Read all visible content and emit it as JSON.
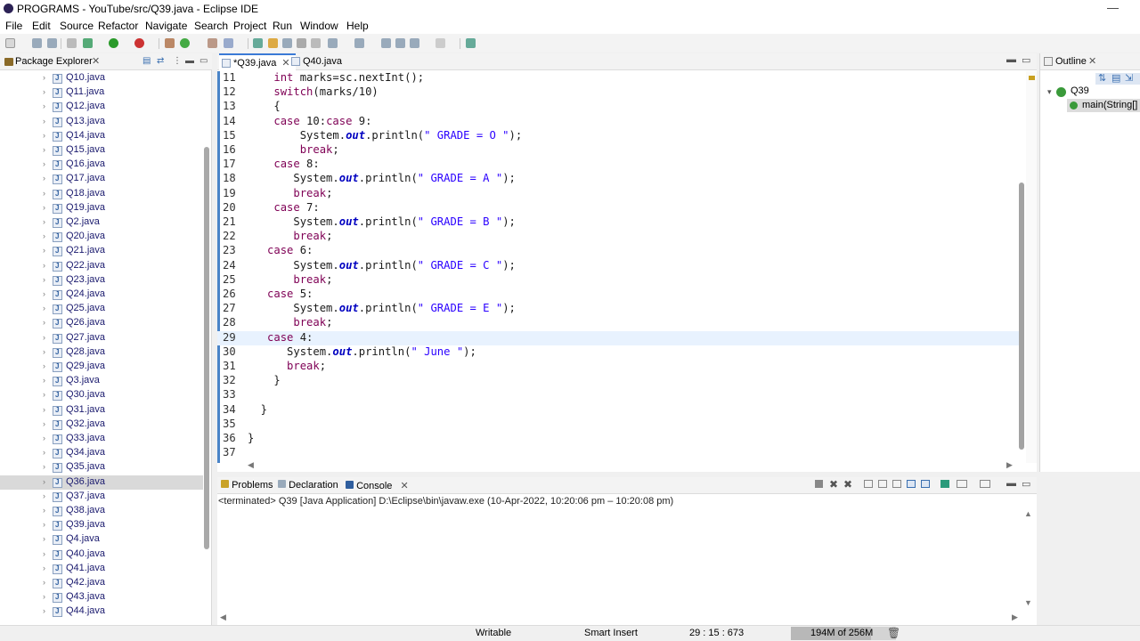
{
  "window": {
    "title": "PROGRAMS - YouTube/src/Q39.java - Eclipse IDE",
    "minimize": "—"
  },
  "menu": [
    "File",
    "Edit",
    "Source",
    "Refactor",
    "Navigate",
    "Search",
    "Project",
    "Run",
    "Window",
    "Help"
  ],
  "package_explorer": {
    "title": "Package Explorer",
    "files": [
      "Q10.java",
      "Q11.java",
      "Q12.java",
      "Q13.java",
      "Q14.java",
      "Q15.java",
      "Q16.java",
      "Q17.java",
      "Q18.java",
      "Q19.java",
      "Q2.java",
      "Q20.java",
      "Q21.java",
      "Q22.java",
      "Q23.java",
      "Q24.java",
      "Q25.java",
      "Q26.java",
      "Q27.java",
      "Q28.java",
      "Q29.java",
      "Q3.java",
      "Q30.java",
      "Q31.java",
      "Q32.java",
      "Q33.java",
      "Q34.java",
      "Q35.java",
      "Q36.java",
      "Q37.java",
      "Q38.java",
      "Q39.java",
      "Q4.java",
      "Q40.java",
      "Q41.java",
      "Q42.java",
      "Q43.java",
      "Q44.java"
    ],
    "selected": "Q36.java"
  },
  "editor": {
    "tabs": [
      {
        "label": "*Q39.java",
        "active": true
      },
      {
        "label": "Q40.java",
        "active": false
      }
    ],
    "current_line": 29,
    "lines": [
      {
        "n": "11",
        "code": "    int marks=sc.nextInt();"
      },
      {
        "n": "12",
        "code": "    switch(marks/10)"
      },
      {
        "n": "13",
        "code": "    {"
      },
      {
        "n": "14",
        "code": "    case 10:case 9:"
      },
      {
        "n": "15",
        "code": "        System.out.println(\" GRADE = O \");"
      },
      {
        "n": "16",
        "code": "        break;"
      },
      {
        "n": "17",
        "code": "    case 8:"
      },
      {
        "n": "18",
        "code": "       System.out.println(\" GRADE = A \");"
      },
      {
        "n": "19",
        "code": "       break;"
      },
      {
        "n": "20",
        "code": "    case 7:"
      },
      {
        "n": "21",
        "code": "       System.out.println(\" GRADE = B \");"
      },
      {
        "n": "22",
        "code": "       break;"
      },
      {
        "n": "23",
        "code": "   case 6:"
      },
      {
        "n": "24",
        "code": "       System.out.println(\" GRADE = C \");"
      },
      {
        "n": "25",
        "code": "       break;"
      },
      {
        "n": "26",
        "code": "   case 5:"
      },
      {
        "n": "27",
        "code": "       System.out.println(\" GRADE = E \");"
      },
      {
        "n": "28",
        "code": "       break;"
      },
      {
        "n": "29",
        "code": "   case 4:"
      },
      {
        "n": "30",
        "code": "      System.out.println(\" June \");"
      },
      {
        "n": "31",
        "code": "      break;"
      },
      {
        "n": "32",
        "code": "    }"
      },
      {
        "n": "33",
        "code": ""
      },
      {
        "n": "34",
        "code": "  }"
      },
      {
        "n": "35",
        "code": ""
      },
      {
        "n": "36",
        "code": "}"
      },
      {
        "n": "37",
        "code": ""
      }
    ]
  },
  "outline": {
    "title": "Outline",
    "class_name": "Q39",
    "method": "main(String[]"
  },
  "console": {
    "tabs": [
      "Problems",
      "Declaration",
      "Console"
    ],
    "terminated": "<terminated> Q39 [Java Application] D:\\Eclipse\\bin\\javaw.exe  (10-Apr-2022, 10:20:06 pm – 10:20:08 pm)"
  },
  "status": {
    "writable": "Writable",
    "insert_mode": "Smart Insert",
    "position": "29 : 15 : 673",
    "heap": "194M of 256M",
    "heap_fraction": 0.76
  },
  "colors": {
    "keyword": "#7f0055",
    "string": "#2a00ff",
    "field": "#0000c0",
    "current_line": "#e8f2fe"
  }
}
